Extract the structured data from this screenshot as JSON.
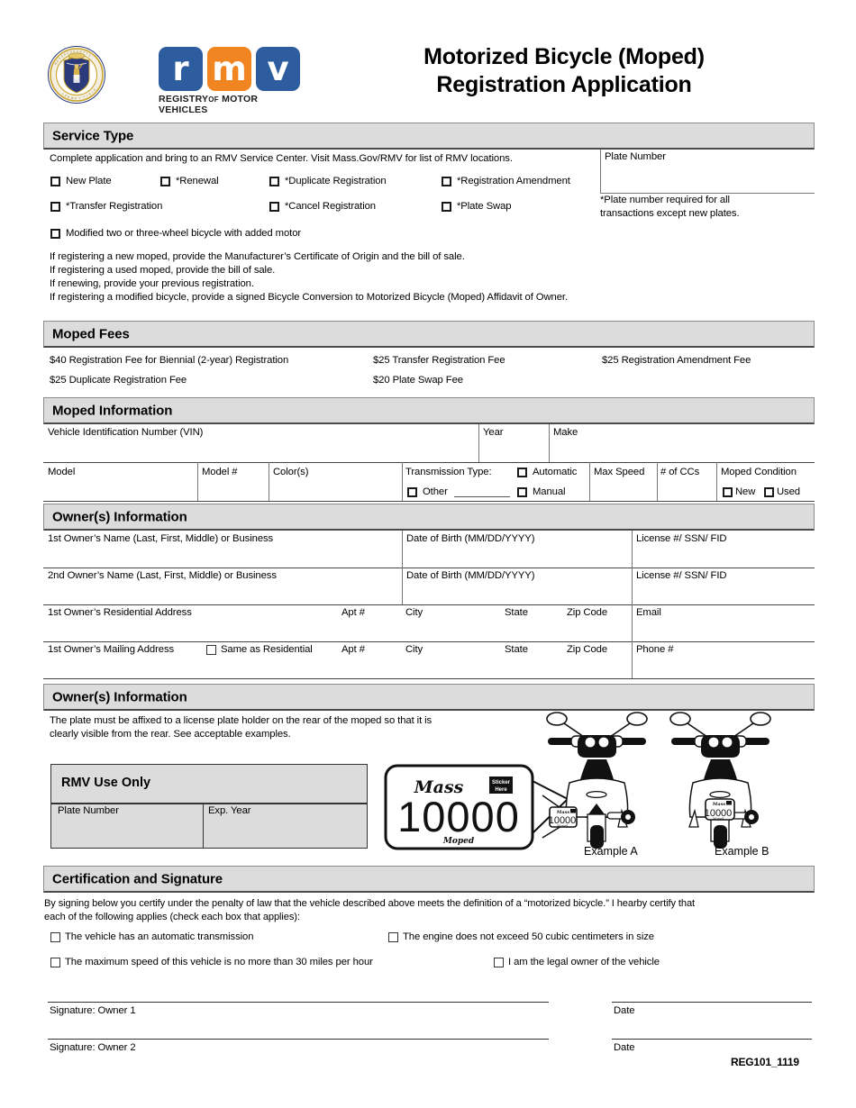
{
  "header": {
    "title_line1": "Motorized Bicycle (Moped)",
    "title_line2": "Registration Application",
    "logo_letters": [
      "r",
      "m",
      "v"
    ],
    "logo_subtitle_a": "REGISTRY",
    "logo_subtitle_b": "OF",
    "logo_subtitle_c": "MOTOR VEHICLES",
    "seal_name": "massachusetts-state-seal"
  },
  "service_type": {
    "heading": "Service Type",
    "instruction": "Complete application and bring to an RMV Service Center. Visit Mass.Gov/RMV for list of RMV locations.",
    "options_row1": [
      "New Plate",
      "*Renewal",
      "*Duplicate Registration",
      "*Registration Amendment"
    ],
    "options_row2": [
      "*Transfer Registration",
      "*Cancel Registration",
      "*Plate Swap"
    ],
    "option_modified": "Modified two or three-wheel bicycle with added motor",
    "plate_number_label": "Plate Number",
    "plate_note_line1": "*Plate number required for all",
    "plate_note_line2": "transactions except new plates.",
    "notes": [
      "If registering a new moped, provide the Manufacturer’s Certificate of Origin and the bill of sale.",
      "If registering a used moped, provide the bill of sale.",
      "If renewing, provide your previous registration.",
      "If registering a modified bicycle, provide a signed Bicycle Conversion to Motorized Bicycle (Moped) Affidavit of Owner."
    ]
  },
  "moped_fees": {
    "heading": "Moped Fees",
    "col1": [
      "$40 Registration Fee for Biennial (2-year) Registration",
      "$25 Duplicate Registration Fee"
    ],
    "col2": [
      "$25 Transfer Registration Fee",
      "$20 Plate Swap Fee"
    ],
    "col3": [
      "$25 Registration Amendment Fee"
    ]
  },
  "moped_information": {
    "heading": "Moped Information",
    "vin": "Vehicle Identification Number (VIN)",
    "year": "Year",
    "make": "Make",
    "model": "Model",
    "model_number": "Model #",
    "colors": "Color(s)",
    "transmission_type": "Transmission Type:",
    "automatic": "Automatic",
    "manual": "Manual",
    "other": "Other",
    "max_speed": "Max Speed",
    "ccs": "# of CCs",
    "condition": "Moped Condition",
    "new": "New",
    "used": "Used"
  },
  "owners_information": {
    "heading": "Owner(s) Information",
    "owner1_name": "1st Owner’s Name (Last, First, Middle) or Business",
    "owner2_name": "2nd Owner’s Name (Last, First, Middle) or Business",
    "dob": "Date of Birth (MM/DD/YYYY)",
    "license": "License #/ SSN/ FID",
    "residential_address": "1st Owner’s Residential Address",
    "mailing_address": "1st Owner’s Mailing Address",
    "same_as_residential": "Same as Residential",
    "apt": "Apt #",
    "city": "City",
    "state": "State",
    "zip": "Zip Code",
    "email": "Email",
    "phone": "Phone #"
  },
  "plate_placement": {
    "heading": "Owner(s) Information",
    "note_line1": "The plate must be affixed to a license plate holder on the rear of the moped so that it is",
    "note_line2": "clearly visible from the rear. See acceptable examples.",
    "rmv_use_only": "RMV Use Only",
    "plate_number": "Plate Number",
    "exp_year": "Exp. Year",
    "plate_state": "Mass",
    "plate_digits": "10000",
    "plate_type": "Moped",
    "plate_sticker_line1": "Sticker",
    "plate_sticker_line2": "Here",
    "example_a": "Example A",
    "example_b": "Example B"
  },
  "certification": {
    "heading": "Certification and Signature",
    "statement_line1": "By signing below you certify under the penalty of law that the vehicle described above meets the definition of a “motorized bicycle.” I hearby certify that",
    "statement_line2": "each of the following applies (check each box that applies):",
    "checkbox_1": "The vehicle has an automatic transmission",
    "checkbox_2": "The engine does not exceed 50 cubic centimeters in size",
    "checkbox_3": "The maximum speed of this vehicle is no more than 30 miles per hour",
    "checkbox_4": "I am the legal owner of the vehicle",
    "signature_owner1": "Signature: Owner 1",
    "signature_owner2": "Signature: Owner 2",
    "date1": "Date",
    "date2": "Date",
    "form_code": "REG101_1119"
  },
  "colors": {
    "band_bg": "#dcdcdc",
    "rmv_blue": "#2d5d9f",
    "rmv_orange": "#f18521",
    "seal_blue": "#2b3a7a",
    "seal_gold": "#c9a227"
  }
}
